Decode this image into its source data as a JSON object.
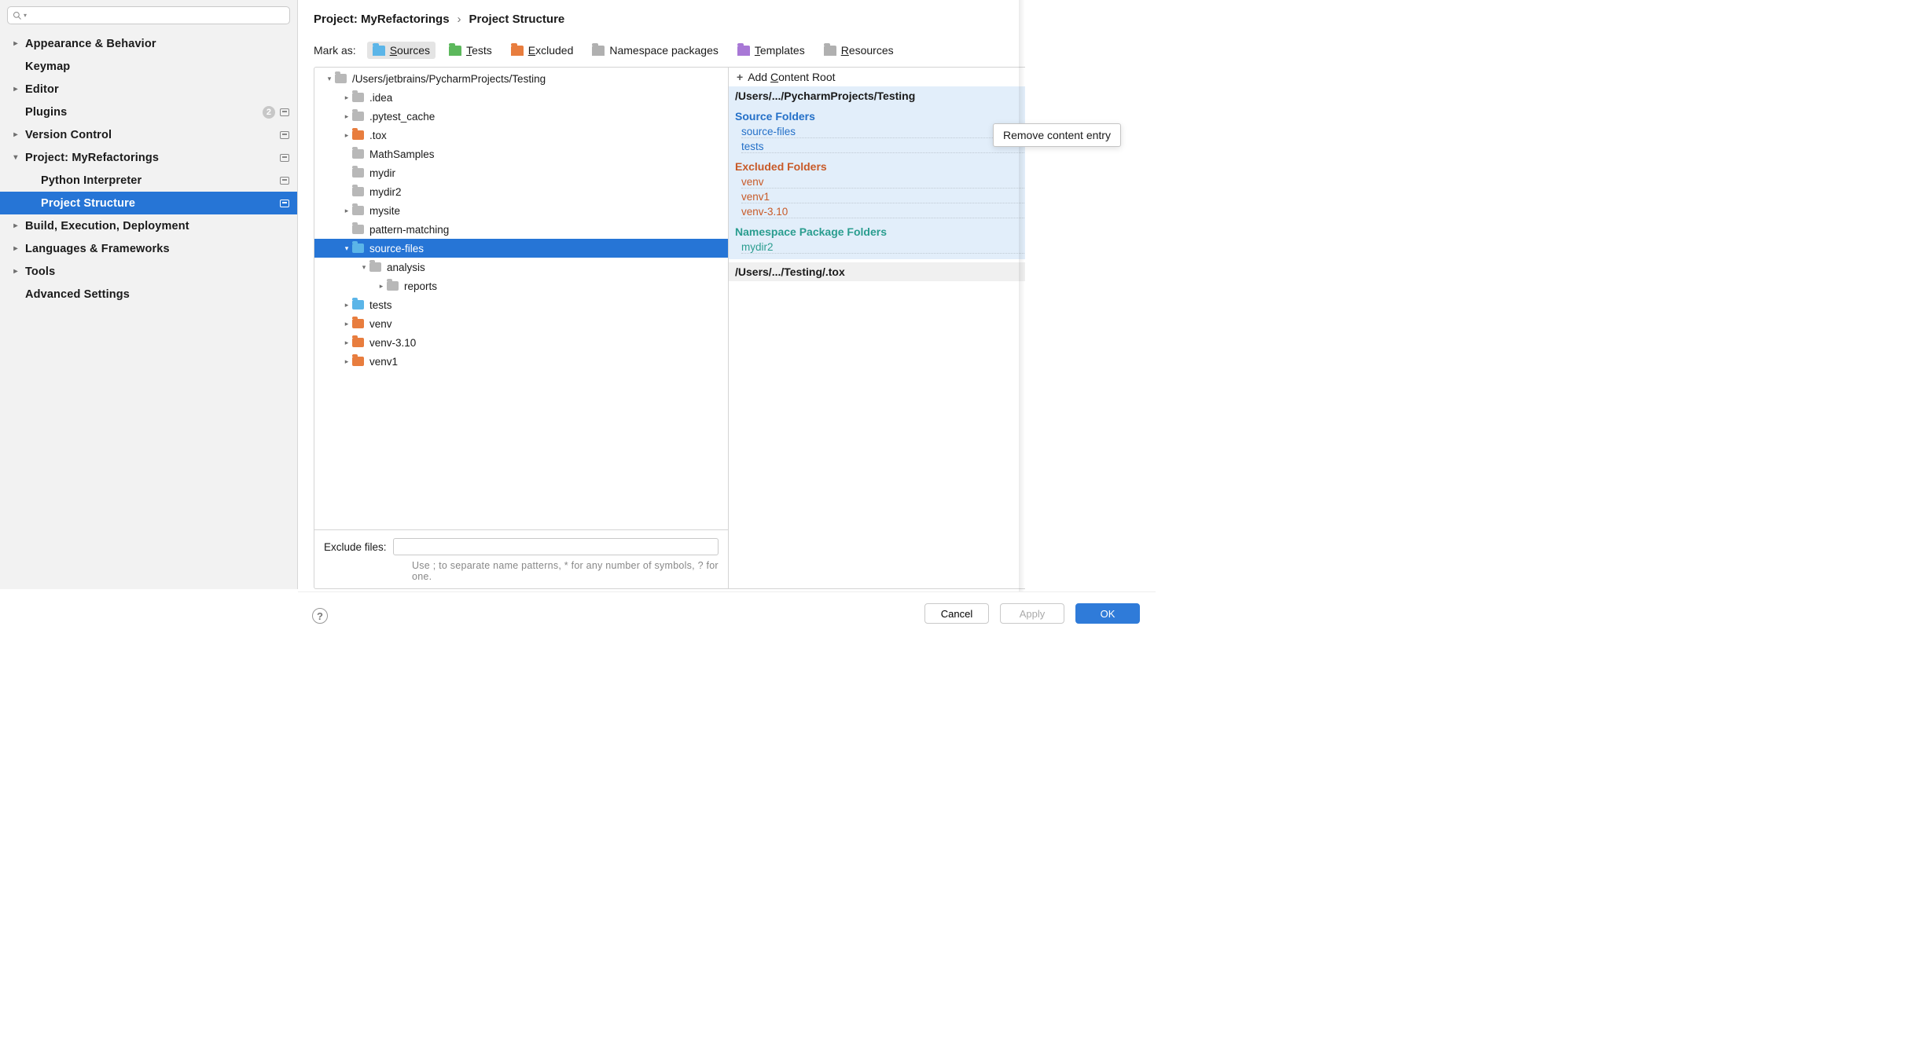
{
  "sidebar": {
    "items": [
      {
        "label": "Appearance & Behavior",
        "expandable": true
      },
      {
        "label": "Keymap",
        "expandable": false
      },
      {
        "label": "Editor",
        "expandable": true
      },
      {
        "label": "Plugins",
        "expandable": false,
        "badge": "2",
        "status": true
      },
      {
        "label": "Version Control",
        "expandable": true,
        "status": true
      },
      {
        "label": "Project: MyRefactorings",
        "expandable": true,
        "expanded": true,
        "status": true
      },
      {
        "label": "Python Interpreter",
        "child": true,
        "status": true
      },
      {
        "label": "Project Structure",
        "child": true,
        "status": true,
        "selected": true
      },
      {
        "label": "Build, Execution, Deployment",
        "expandable": true
      },
      {
        "label": "Languages & Frameworks",
        "expandable": true
      },
      {
        "label": "Tools",
        "expandable": true
      },
      {
        "label": "Advanced Settings",
        "expandable": false
      }
    ]
  },
  "breadcrumb": {
    "p1": "Project: MyRefactorings",
    "p2": "Project Structure"
  },
  "markas": {
    "label": "Mark as:",
    "sources": "Sources",
    "tests": "Tests",
    "excluded": "Excluded",
    "namespace": "Namespace packages",
    "templates": "Templates",
    "resources": "Resources"
  },
  "filetree": [
    {
      "depth": 0,
      "chev": "down",
      "color": "grey",
      "label": "/Users/jetbrains/PycharmProjects/Testing"
    },
    {
      "depth": 1,
      "chev": "right",
      "color": "grey",
      "label": ".idea"
    },
    {
      "depth": 1,
      "chev": "right",
      "color": "grey",
      "label": ".pytest_cache"
    },
    {
      "depth": 1,
      "chev": "right",
      "color": "orange",
      "label": ".tox"
    },
    {
      "depth": 1,
      "chev": "",
      "color": "grey",
      "label": "MathSamples"
    },
    {
      "depth": 1,
      "chev": "",
      "color": "grey",
      "label": "mydir"
    },
    {
      "depth": 1,
      "chev": "",
      "color": "grey",
      "label": "mydir2"
    },
    {
      "depth": 1,
      "chev": "right",
      "color": "grey",
      "label": "mysite"
    },
    {
      "depth": 1,
      "chev": "",
      "color": "grey",
      "label": "pattern-matching"
    },
    {
      "depth": 1,
      "chev": "down",
      "color": "blue",
      "label": "source-files",
      "selected": true
    },
    {
      "depth": 2,
      "chev": "down",
      "color": "grey",
      "label": "analysis"
    },
    {
      "depth": 3,
      "chev": "right",
      "color": "grey",
      "label": "reports"
    },
    {
      "depth": 1,
      "chev": "right",
      "color": "blue",
      "label": "tests"
    },
    {
      "depth": 1,
      "chev": "right",
      "color": "orange",
      "label": "venv"
    },
    {
      "depth": 1,
      "chev": "right",
      "color": "orange",
      "label": "venv-3.10"
    },
    {
      "depth": 1,
      "chev": "right",
      "color": "orange",
      "label": "venv1"
    }
  ],
  "exclude": {
    "label": "Exclude files:",
    "hint": "Use ; to separate name patterns, * for any number of symbols, ? for one."
  },
  "roots": {
    "add_label": "Add Content Root",
    "entry1": "/Users/.../PycharmProjects/Testing",
    "source_title": "Source Folders",
    "source_items": [
      "source-files",
      "tests"
    ],
    "excluded_title": "Excluded Folders",
    "excluded_items": [
      "venv",
      "venv1",
      "venv-3.10"
    ],
    "namespace_title": "Namespace Package Folders",
    "namespace_items": [
      "mydir2"
    ],
    "entry2": "/Users/.../Testing/.tox"
  },
  "buttons": {
    "cancel": "Cancel",
    "apply": "Apply",
    "ok": "OK"
  },
  "tooltip": "Remove content entry"
}
